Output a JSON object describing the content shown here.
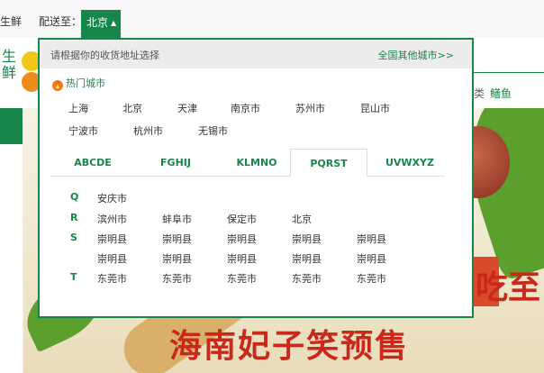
{
  "topbar": {
    "brand_fragment": "生鲜",
    "ship_to_label": "配送至：",
    "current_city": "北京"
  },
  "logo": {
    "text": "生鲜"
  },
  "nav": {
    "item_lei": "类",
    "item_gui": "鳝鱼"
  },
  "banner": {
    "headline": "海南妃子笑预售",
    "side_text": "吃至"
  },
  "dropdown": {
    "hint": "请根据你的收货地址选择",
    "other_cities": "全国其他城市>>",
    "hot_title": "热门城市",
    "hot_cities": [
      "上海",
      "北京",
      "天津",
      "南京市",
      "苏州市",
      "昆山市",
      "宁波市",
      "杭州市",
      "无锡市"
    ],
    "tabs": [
      "ABCDE",
      "FGHIJ",
      "KLMNO",
      "PQRST",
      "UVWXYZ"
    ],
    "active_tab": "PQRST",
    "groups": [
      {
        "letter": "Q",
        "rows": [
          [
            "安庆市"
          ]
        ]
      },
      {
        "letter": "R",
        "rows": [
          [
            "滨州市",
            "蚌阜市",
            "保定市",
            "北京"
          ]
        ]
      },
      {
        "letter": "S",
        "rows": [
          [
            "崇明县",
            "崇明县",
            "崇明县",
            "崇明县",
            "崇明县"
          ],
          [
            "崇明县",
            "崇明县",
            "崇明县",
            "崇明县",
            "崇明县"
          ]
        ]
      },
      {
        "letter": "T",
        "rows": [
          [
            "东莞市",
            "东莞市",
            "东莞市",
            "东莞市",
            "东莞市"
          ]
        ]
      }
    ]
  },
  "colors": {
    "accent": "#17864a",
    "headline_red": "#c8291b",
    "fire_orange": "#ef7a1a"
  }
}
